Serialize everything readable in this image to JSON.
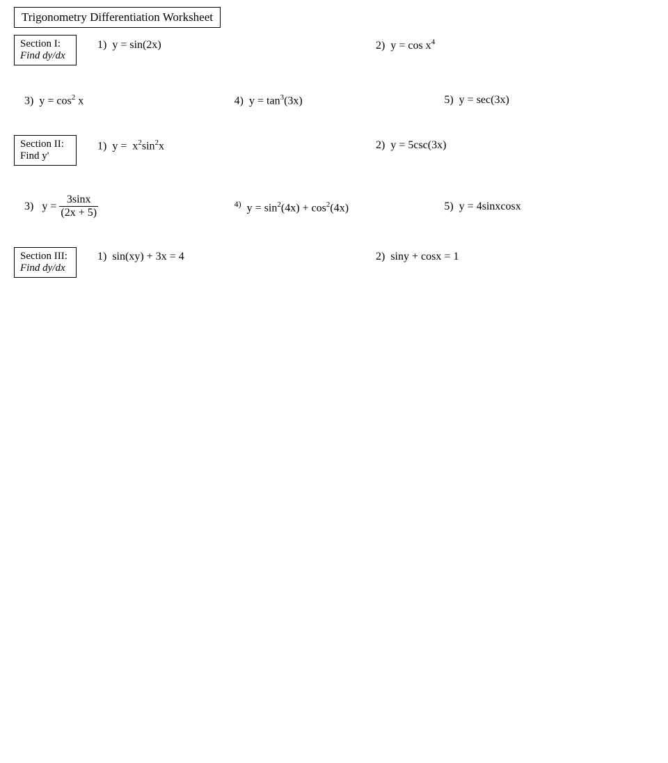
{
  "title": "Trigonometry Differentiation Worksheet",
  "section1": {
    "label": "Section I:",
    "find": "Find dy/dx",
    "problems": [
      {
        "num": "1)",
        "expr": "y = sin(2x)"
      },
      {
        "num": "2)",
        "expr": "y = cos x⁴"
      }
    ],
    "problems2": [
      {
        "num": "3)",
        "expr": "y = cos² x"
      },
      {
        "num": "4)",
        "expr": "y = tan³(3x)"
      },
      {
        "num": "5)",
        "expr": "y = sec(3x)"
      }
    ]
  },
  "section2": {
    "label": "Section II:",
    "find": "Find y'",
    "problems": [
      {
        "num": "1)",
        "expr": "y = x²sin²x"
      },
      {
        "num": "2)",
        "expr": "y = 5csc(3x)"
      }
    ],
    "problems2": [
      {
        "num": "3)",
        "expr_frac": true
      },
      {
        "num": "4)",
        "expr": "y = sin²(4x) + cos²(4x)"
      },
      {
        "num": "5)",
        "expr": "y = 4sinxcosx"
      }
    ]
  },
  "section3": {
    "label": "Section III:",
    "find": "Find dy/dx",
    "problems": [
      {
        "num": "1)",
        "expr": "sin(xy) + 3x = 4"
      },
      {
        "num": "2)",
        "expr": "siny + cosx = 1"
      }
    ]
  }
}
